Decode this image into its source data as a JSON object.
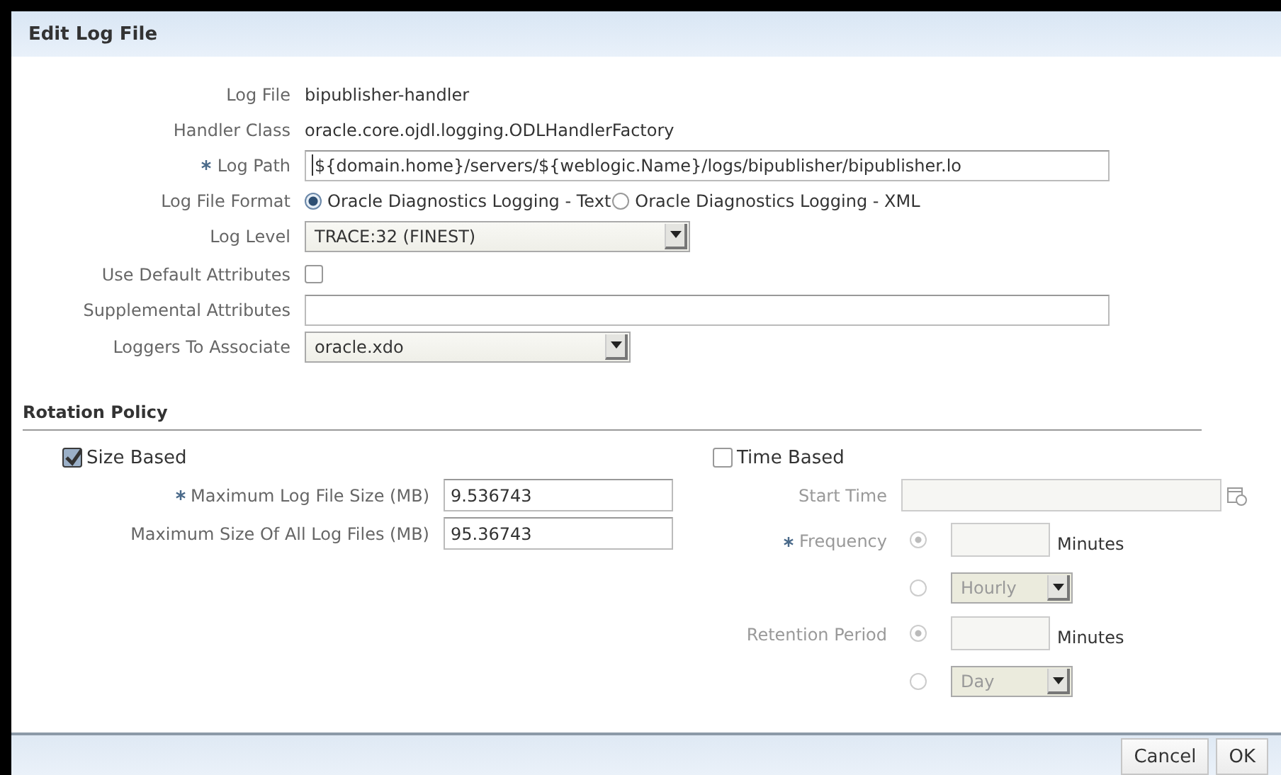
{
  "dialog": {
    "title": "Edit Log File"
  },
  "fields": [
    {
      "kind": "text",
      "label": "Log File",
      "required": false,
      "value": "bipublisher-handler"
    },
    {
      "kind": "text",
      "label": "Handler Class",
      "required": false,
      "value": "oracle.core.ojdl.logging.ODLHandlerFactory"
    },
    {
      "kind": "input",
      "label": "Log Path",
      "required": true,
      "value": "${domain.home}/servers/${weblogic.Name}/logs/bipublisher/bipublisher.lo"
    },
    {
      "kind": "radio",
      "label": "Log File Format",
      "required": false,
      "options": [
        {
          "label": "Oracle Diagnostics Logging - Text",
          "selected": true
        },
        {
          "label": "Oracle Diagnostics Logging - XML",
          "selected": false
        }
      ]
    },
    {
      "kind": "select",
      "label": "Log Level",
      "required": false,
      "value": "TRACE:32 (FINEST)"
    },
    {
      "kind": "checkbox",
      "label": "Use Default Attributes",
      "required": false,
      "checked": false
    },
    {
      "kind": "input",
      "label": "Supplemental Attributes",
      "required": false
    },
    {
      "kind": "select",
      "label": "Loggers To Associate",
      "required": false,
      "value": "oracle.xdo"
    }
  ],
  "rotation_policy": {
    "title": "Rotation Policy",
    "size_based": {
      "label": "Size Based",
      "checked": true,
      "fields": [
        {
          "label": "Maximum Log File Size (MB)",
          "required": true,
          "value": "9.536743"
        },
        {
          "label": "Maximum Size Of All Log Files (MB)",
          "required": false,
          "value": "95.36743"
        }
      ]
    },
    "time_based": {
      "label": "Time Based",
      "checked": false,
      "start_time": {
        "label": "Start Time"
      },
      "groups": [
        {
          "label": "Frequency",
          "required": true,
          "options": [
            {
              "kind": "input",
              "unit": "Minutes",
              "selected": true
            },
            {
              "kind": "select",
              "value": "Hourly",
              "selected": false
            }
          ]
        },
        {
          "label": "Retention Period",
          "required": false,
          "options": [
            {
              "kind": "input",
              "unit": "Minutes",
              "selected": true
            },
            {
              "kind": "select",
              "value": "Day",
              "selected": false
            }
          ]
        }
      ]
    }
  },
  "buttons": [
    {
      "label": "Cancel"
    },
    {
      "label": "OK"
    }
  ]
}
